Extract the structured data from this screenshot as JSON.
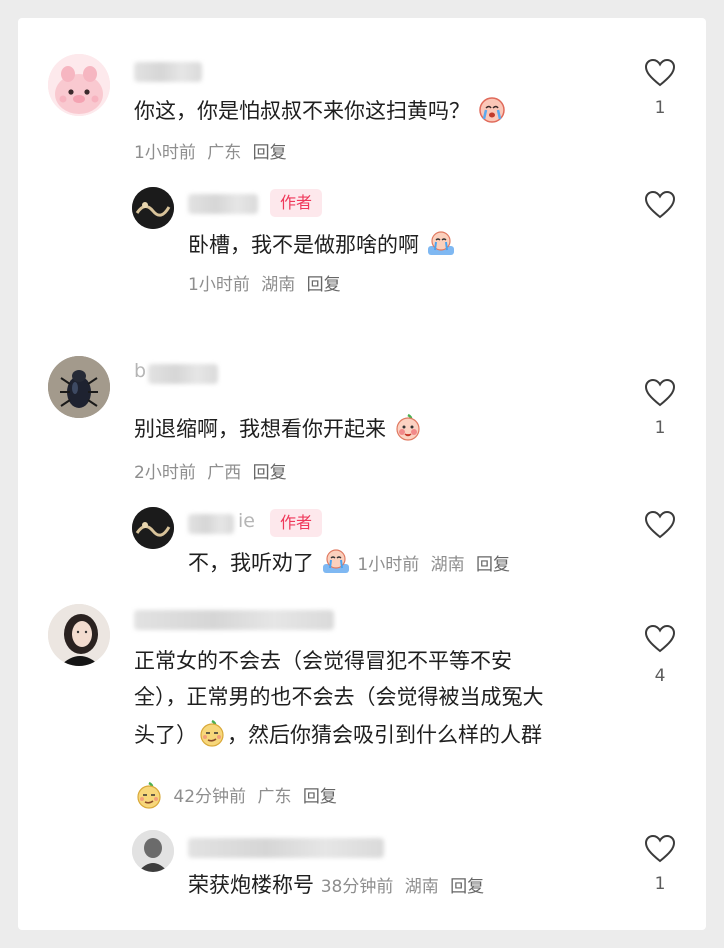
{
  "comments": [
    {
      "avatar": "pink-pig-avatar",
      "text": "你这，你是怕叔叔不来你这扫黄吗？",
      "emoji": "crying-face-emoji",
      "time": "1小时前",
      "location": "广东",
      "reply_label": "回复",
      "likes": "1",
      "reply": {
        "avatar": "author-avatar",
        "badge": "作者",
        "text": "卧槽，我不是做那啥的啊",
        "emoji": "crying-bath-emoji",
        "time": "1小时前",
        "location": "湖南",
        "reply_label": "回复"
      }
    },
    {
      "avatar": "beetle-avatar",
      "name_visible": "b",
      "text": "别退缩啊，我想看你开起来",
      "emoji": "blushing-peach-emoji",
      "time": "2小时前",
      "location": "广西",
      "reply_label": "回复",
      "likes": "1",
      "reply": {
        "avatar": "author-avatar",
        "name_visible": "ie",
        "badge": "作者",
        "text": "不，我听劝了",
        "emoji": "crying-bath-emoji",
        "time": "1小时前",
        "location": "湖南",
        "reply_label": "回复"
      }
    },
    {
      "avatar": "woman-portrait-avatar",
      "text_lines": [
        "正常女的不会去（会觉得冒犯不平等不安",
        "全），正常男的也不会去（会觉得被当成冤大",
        "头了）",
        "，然后你猜会吸引到什么样的人群"
      ],
      "emoji": "smirk-peach-emoji",
      "time": "42分钟前",
      "location": "广东",
      "reply_label": "回复",
      "likes": "4",
      "reply": {
        "avatar": "sketch-avatar",
        "text": "荣获炮楼称号",
        "time": "38分钟前",
        "location": "湖南",
        "reply_label": "回复",
        "likes": "1"
      }
    }
  ]
}
